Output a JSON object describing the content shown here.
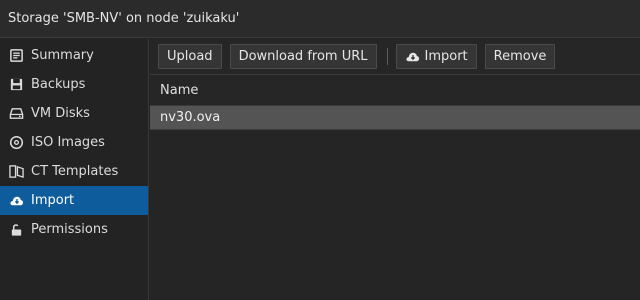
{
  "title": "Storage 'SMB-NV' on node 'zuikaku'",
  "sidebar": {
    "items": [
      {
        "label": "Summary",
        "icon": "summary-icon"
      },
      {
        "label": "Backups",
        "icon": "backup-icon"
      },
      {
        "label": "VM Disks",
        "icon": "vm-disk-icon"
      },
      {
        "label": "ISO Images",
        "icon": "iso-image-icon"
      },
      {
        "label": "CT Templates",
        "icon": "ct-template-icon"
      },
      {
        "label": "Import",
        "icon": "cloud-download-icon",
        "active": true
      },
      {
        "label": "Permissions",
        "icon": "unlock-icon"
      }
    ]
  },
  "toolbar": {
    "upload_label": "Upload",
    "download_url_label": "Download from URL",
    "import_label": "Import",
    "remove_label": "Remove"
  },
  "grid": {
    "columns": [
      "Name"
    ],
    "rows": [
      {
        "name": "nv30.ova",
        "selected": true
      }
    ]
  },
  "colors": {
    "accent": "#0e5c9c",
    "background": "#232323",
    "selected_row": "#545454"
  }
}
